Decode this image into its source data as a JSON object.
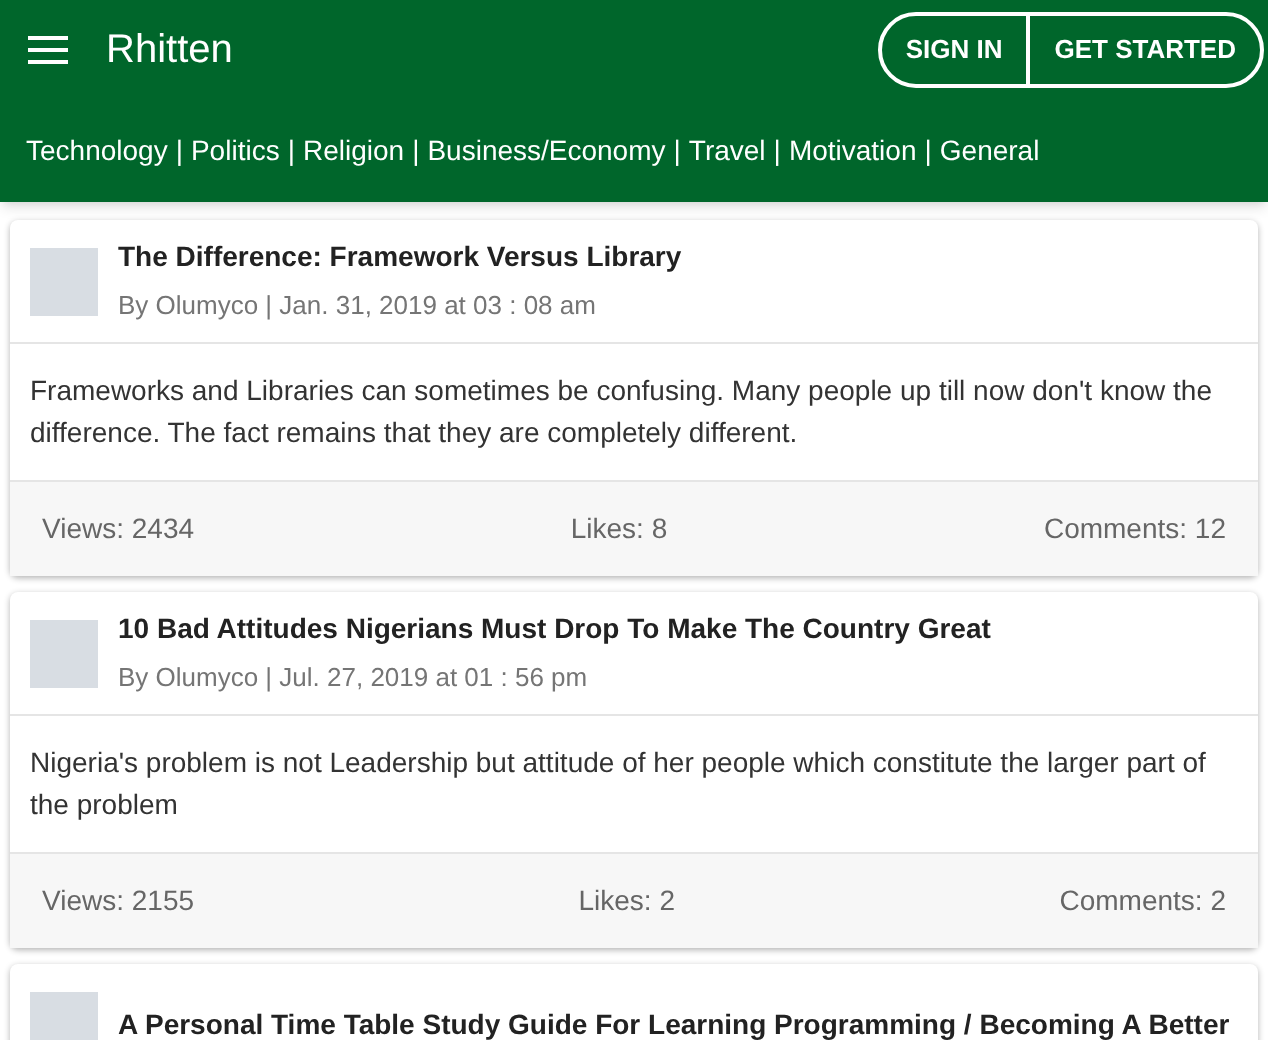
{
  "header": {
    "title": "Rhitten",
    "buttons": [
      "SIGN IN",
      "GET STARTED"
    ]
  },
  "categories": {
    "separator": "|",
    "items": [
      "Technology",
      "Politics",
      "Religion",
      "Business/Economy",
      "Travel",
      "Motivation",
      "General"
    ]
  },
  "posts": [
    {
      "title": "The Difference: Framework Versus Library",
      "meta": "By Olumyco | Jan. 31, 2019 at 03 : 08 am",
      "excerpt": "Frameworks and Libraries can sometimes be confusing. Many people up till now don't know the difference. The fact remains that they are completely different.",
      "views": "Views: 2434",
      "likes": "Likes: 8",
      "comments": "Comments: 12"
    },
    {
      "title": "10 Bad Attitudes Nigerians Must Drop To Make The Country Great",
      "meta": "By Olumyco | Jul. 27, 2019 at 01 : 56 pm",
      "excerpt": "Nigeria's problem is not Leadership but attitude of her people which constitute the larger part of the problem",
      "views": "Views: 2155",
      "likes": "Likes: 2",
      "comments": "Comments: 2"
    },
    {
      "title": "A Personal Time Table Study Guide For Learning Programming / Becoming A Better"
    }
  ]
}
